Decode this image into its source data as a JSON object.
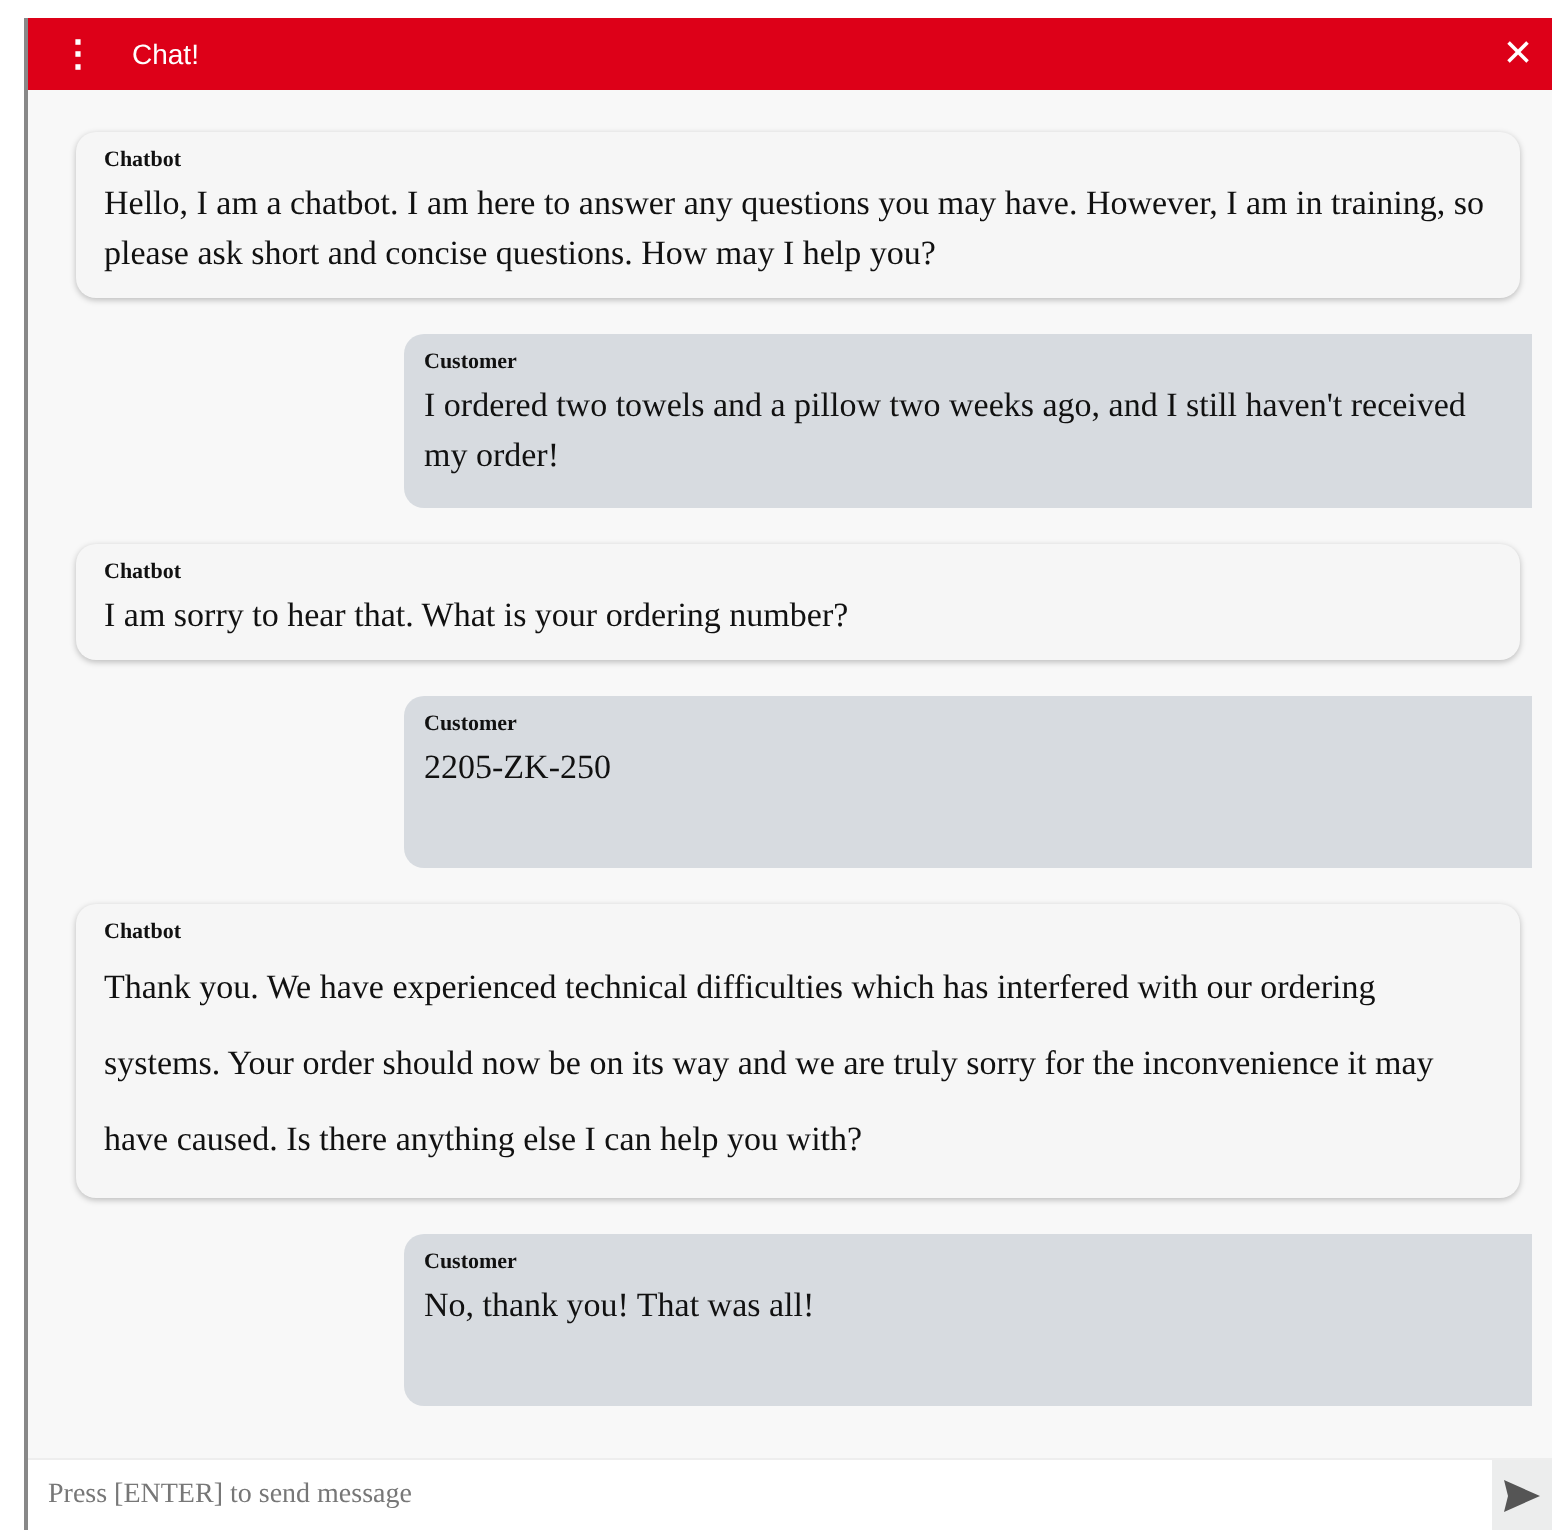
{
  "header": {
    "menu_icon": "⋮",
    "title": "Chat!",
    "close_icon": "×"
  },
  "messages": [
    {
      "kind": "bot",
      "sender": "Chatbot",
      "text": "Hello, I am a chatbot. I am here to answer any questions you may have. However, I am in training, so please ask short and concise questions. How may I help you?"
    },
    {
      "kind": "customer",
      "sender": "Customer",
      "text": "I ordered two towels and a pillow two weeks ago, and I still haven't received my order!"
    },
    {
      "kind": "bot",
      "sender": "Chatbot",
      "text": "I am sorry to hear that. What is your ordering number?"
    },
    {
      "kind": "customer",
      "sender": "Customer",
      "text": "2205-ZK-250"
    },
    {
      "kind": "bot",
      "sender": "Chatbot",
      "text": " Thank you. We have experienced technical difficulties which has interfered with our ordering systems. Your order should now be on its way and we are truly sorry for the inconvenience it may have caused. Is there anything else I can help you with?"
    },
    {
      "kind": "customer",
      "sender": "Customer",
      "text": "No, thank you! That was all!"
    }
  ],
  "composer": {
    "placeholder": "Press [ENTER] to send message"
  }
}
